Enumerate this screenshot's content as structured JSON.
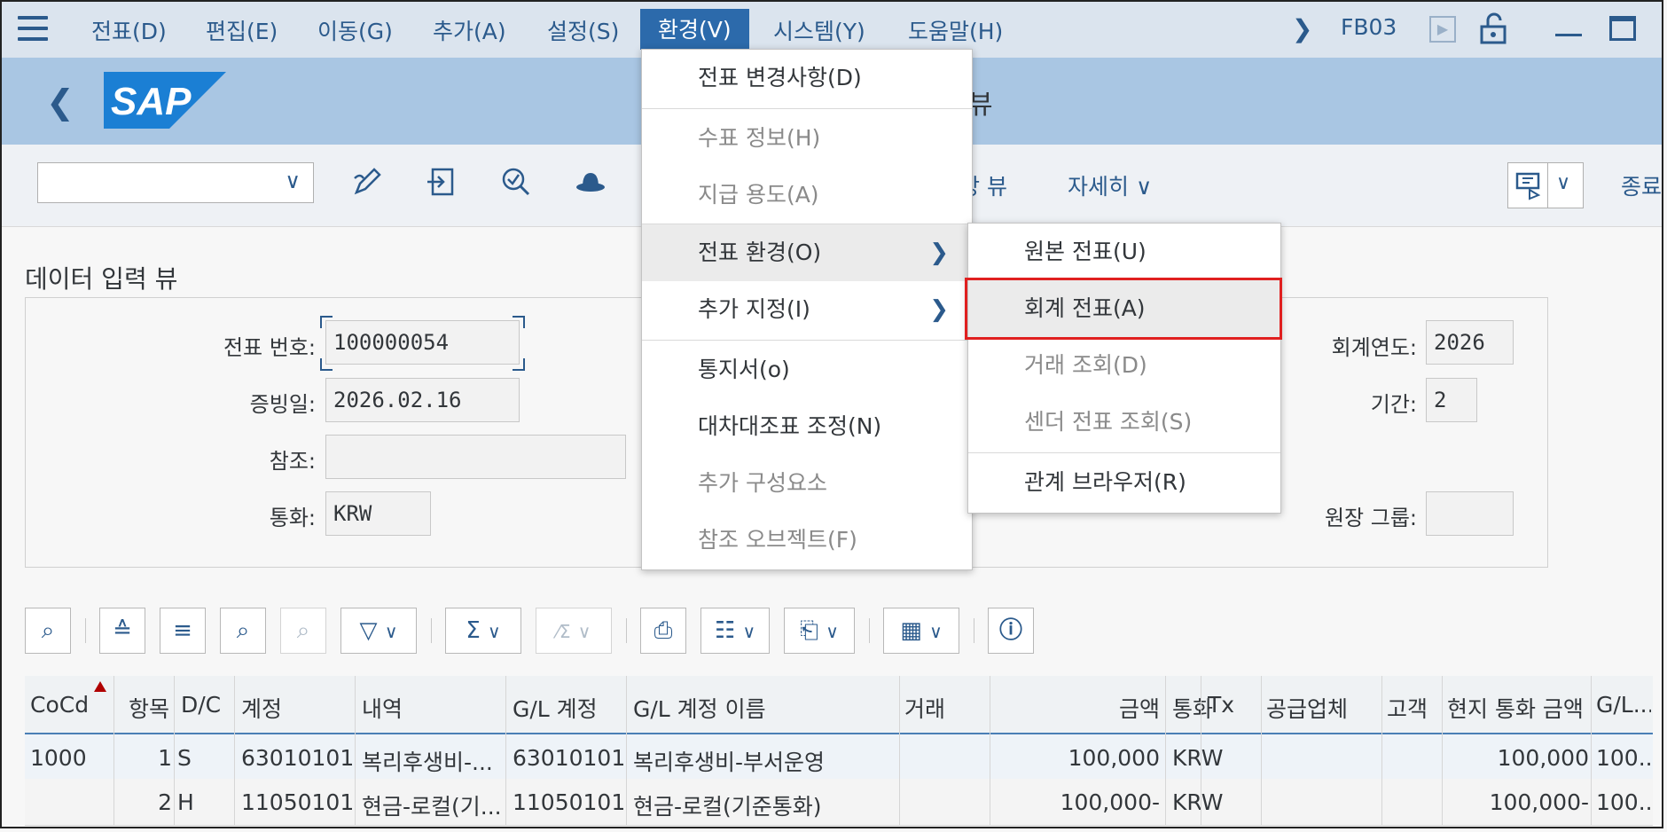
{
  "menubar": {
    "items": [
      "전표(D)",
      "편집(E)",
      "이동(G)",
      "추가(A)",
      "설정(S)",
      "환경(V)",
      "시스템(Y)",
      "도움말(H)"
    ],
    "transaction": "FB03"
  },
  "header": {
    "logo_text": "SAP",
    "title_fragment": "뷰"
  },
  "toolbar": {
    "view_select_value": "",
    "ledger_view": "장 뷰",
    "more": "자세히",
    "exit": "종료"
  },
  "form": {
    "section_title": "데이터 입력 뷰",
    "doc_number_label": "전표 번호:",
    "doc_number": "100000054",
    "doc_date_label": "증빙일:",
    "doc_date": "2026.02.16",
    "reference_label": "참조:",
    "reference": "",
    "currency_label": "통화:",
    "currency": "KRW",
    "fiscal_year_label": "회계연도:",
    "fiscal_year": "2026",
    "period_label": "기간:",
    "period": "2",
    "ledger_group_label": "원장 그룹:",
    "ledger_group": ""
  },
  "table": {
    "headers": [
      "CoCd",
      "항목",
      "D/C",
      "계정",
      "내역",
      "G/L 계정",
      "G/L 계정 이름",
      "거래",
      "금액",
      "통화",
      "Tx",
      "공급업체",
      "고객",
      "현지 통화 금액",
      "G/L..."
    ],
    "rows": [
      [
        "1000",
        "1",
        "S",
        "63010101",
        "복리후생비-...",
        "63010101",
        "복리후생비-부서운영",
        "",
        "100,000",
        "KRW",
        "",
        "",
        "",
        "100,000",
        "100..."
      ],
      [
        "",
        "2",
        "H",
        "11050101",
        "현금-로컬(기...",
        "11050101",
        "현금-로컬(기준통화)",
        "",
        "100,000-",
        "KRW",
        "",
        "",
        "",
        "100,000-",
        "100..."
      ]
    ]
  },
  "menu_environment": {
    "items": [
      "전표 변경사항(D)",
      "수표 정보(H)",
      "지급 용도(A)",
      "전표 환경(O)",
      "추가 지정(I)",
      "통지서(o)",
      "대차대조표 조정(N)",
      "추가 구성요소",
      "참조 오브젝트(F)"
    ]
  },
  "submenu_doc_env": {
    "items": [
      "원본 전표(U)",
      "회계 전표(A)",
      "거래 조회(D)",
      "센더 전표 조회(S)",
      "관계 브라우저(R)"
    ]
  },
  "colors": {
    "menubar_bg": "#dbe4ee",
    "header_bg": "#a9c6e3",
    "accent": "#2b5a8c",
    "active_menu": "#2c6aab",
    "highlight_border": "#e02020"
  }
}
